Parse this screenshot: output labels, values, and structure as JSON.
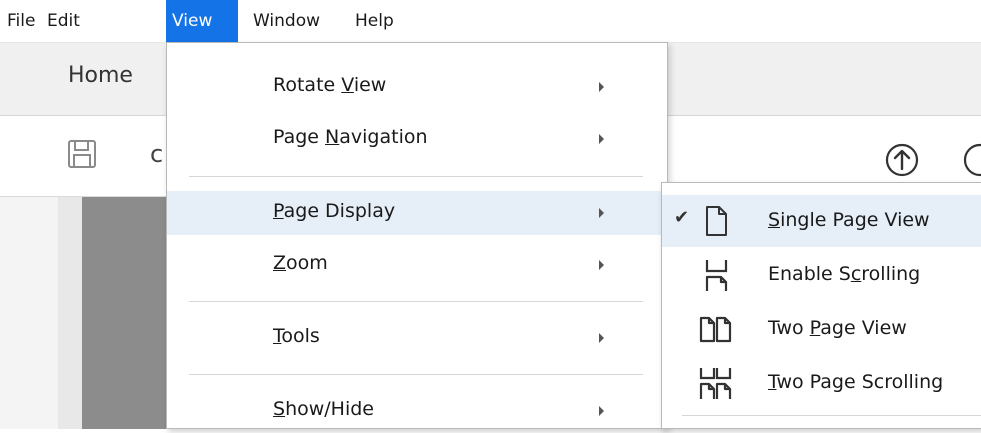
{
  "menubar": {
    "items": [
      {
        "label": "File"
      },
      {
        "label": "Edit"
      },
      {
        "label": "View",
        "active": true
      },
      {
        "label": "Window"
      },
      {
        "label": "Help"
      }
    ]
  },
  "tabs": {
    "home": "Home"
  },
  "toolbar": {
    "partial_glyph": "c"
  },
  "view_menu": {
    "items": [
      {
        "pre": "Rotate ",
        "mn": "V",
        "post": "iew"
      },
      {
        "pre": "Page ",
        "mn": "N",
        "post": "avigation"
      },
      {
        "pre": "",
        "mn": "P",
        "post": "age Display",
        "highlighted": true
      },
      {
        "pre": "",
        "mn": "Z",
        "post": "oom"
      },
      {
        "pre": "",
        "mn": "T",
        "post": "ools"
      },
      {
        "pre": "",
        "mn": "S",
        "post": "how/Hide"
      }
    ]
  },
  "page_display_submenu": {
    "items": [
      {
        "pre": "",
        "mn": "S",
        "post": "ingle Page View",
        "checked": true,
        "icon": "single-page-icon"
      },
      {
        "pre": "Enable S",
        "mn": "c",
        "post": "rolling",
        "icon": "enable-scrolling-icon"
      },
      {
        "pre": "Two ",
        "mn": "P",
        "post": "age View",
        "icon": "two-page-icon"
      },
      {
        "pre": "",
        "mn": "T",
        "post": "wo Page Scrolling",
        "icon": "two-page-scrolling-icon"
      }
    ],
    "check_glyph": "✔"
  },
  "colors": {
    "accent": "#1473e6",
    "highlight": "#e6eef8"
  }
}
